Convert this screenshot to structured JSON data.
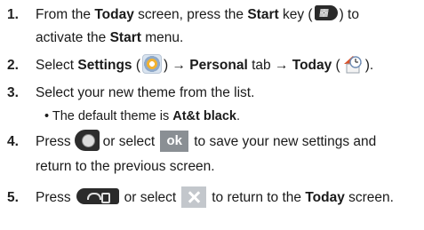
{
  "steps": [
    {
      "number": "1.",
      "line1": {
        "t1": "From the ",
        "b1": "Today",
        "t2": " screen, press the ",
        "b2": "Start",
        "t3": " key (",
        "t4": ") to"
      },
      "line2": {
        "t1": "activate the ",
        "b1": "Start",
        "t2": " menu."
      }
    },
    {
      "number": "2.",
      "line1": {
        "t1": "Select ",
        "b1": "Settings",
        "t2": " (",
        "t3": ") → ",
        "b2": "Personal",
        "t4": " tab → ",
        "b3": "Today",
        "t5": " (",
        "t6": ")."
      }
    },
    {
      "number": "3.",
      "line1": {
        "t1": "Select your new theme from the list."
      },
      "bullet": {
        "t1": "• The default theme is ",
        "b1": "At&t black",
        "t2": "."
      }
    },
    {
      "number": "4.",
      "line1": {
        "t1": "Press",
        "t2": "or select",
        "t3": "to save your new settings and"
      },
      "line2": {
        "t1": "return to the previous screen."
      },
      "ok_label": "ok"
    },
    {
      "number": "5.",
      "line1": {
        "t1": "Press",
        "t2": "or select",
        "t3": "to return to the ",
        "b1": "Today",
        "t4": " screen."
      }
    }
  ],
  "icons": {
    "start_key": "windows-start-key-icon",
    "settings": "settings-icon",
    "today": "today-house-clock-icon",
    "select_key": "round-select-key-icon",
    "ok_button": "ok-softkey-icon",
    "end_key": "end-power-key-icon",
    "close_button": "close-x-icon"
  },
  "colors": {
    "text": "#1a1a1a",
    "ok_button_bg": "#8a8f94",
    "close_button_bg": "#c3c7cc"
  }
}
